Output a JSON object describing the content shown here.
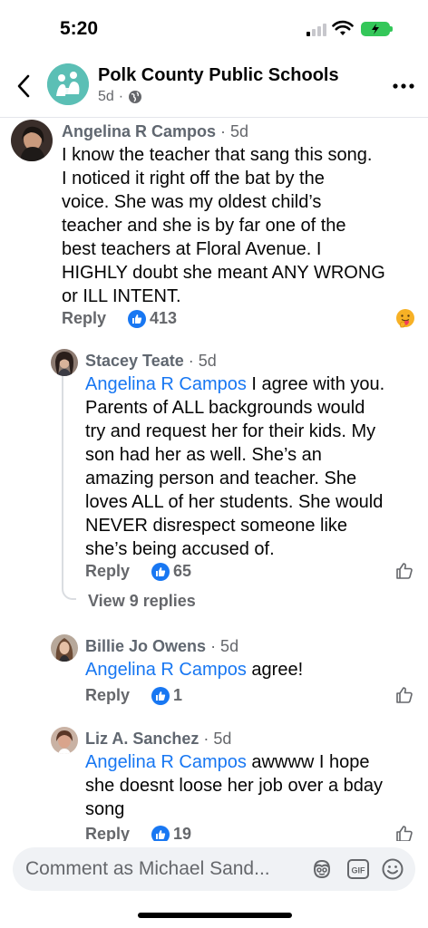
{
  "status_bar": {
    "time": "5:20"
  },
  "header": {
    "page_name": "Polk County Public Schools",
    "age": "5d",
    "separator": "·"
  },
  "comments": [
    {
      "author": "Angelina R Campos",
      "age": "· 5d",
      "lines": [
        "I know the teacher that sang this song.",
        "I noticed it right off the bat by the",
        "voice. She was my oldest child’s",
        "teacher and she is by far one of the",
        "best teachers at Floral Avenue. I",
        "HIGHLY doubt she meant ANY WRONG",
        "or ILL INTENT."
      ],
      "reply_label": "Reply",
      "like_count": "413",
      "reaction_icon": "care-emoji-icon"
    },
    {
      "author": "Stacey Teate",
      "age": "· 5d",
      "mention": "Angelina R Campos",
      "first_line_rest": " I agree with you.",
      "lines": [
        "Parents of ALL backgrounds would",
        "try and request her for their kids. My",
        "son had her as well. She’s an",
        "amazing person and teacher. She",
        "loves ALL of her students. She would",
        "NEVER disrespect someone like",
        "she’s being accused of."
      ],
      "reply_label": "Reply",
      "like_count": "65",
      "view_replies": "View 9 replies"
    },
    {
      "author": "Billie Jo Owens",
      "age": "· 5d",
      "mention": "Angelina R Campos",
      "first_line_rest": " agree!",
      "reply_label": "Reply",
      "like_count": "1"
    },
    {
      "author": "Liz A. Sanchez",
      "age": "· 5d",
      "mention": "Angelina R Campos",
      "first_line_rest": " awwww I hope",
      "lines": [
        "she doesnt loose her job over a bday",
        "song"
      ],
      "reply_label": "Reply",
      "like_count": "19"
    }
  ],
  "composer": {
    "placeholder": "Comment as Michael Sand...",
    "icons": [
      "avatar-sticker-icon",
      "gif-icon",
      "emoji-icon"
    ]
  },
  "colors": {
    "link_blue": "#1877f2",
    "secondary_text": "#65676b",
    "composer_bg": "#f0f2f5",
    "battery_green": "#34c759"
  }
}
